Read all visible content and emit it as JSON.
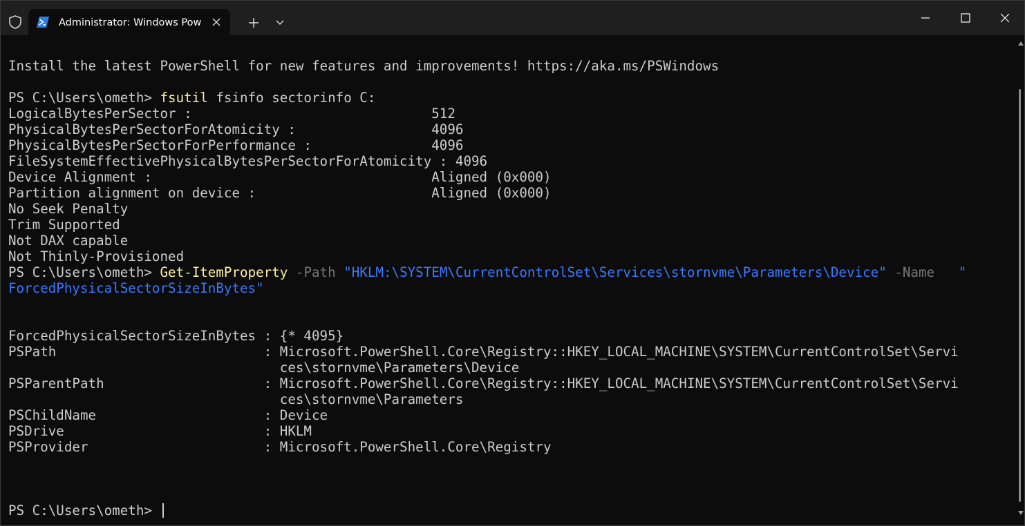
{
  "titlebar": {
    "tab_title": "Administrator: Windows PowerShell",
    "icons": [
      "shield-icon",
      "powershell-icon",
      "close-icon",
      "plus-icon",
      "chevron-down-icon",
      "minimize-icon",
      "maximize-icon",
      "close-icon"
    ]
  },
  "terminal": {
    "banner": "Install the latest PowerShell for new features and improvements! https://aka.ms/PSWindows",
    "cmd1": {
      "prompt": "PS C:\\Users\\ometh> ",
      "command": "fsutil",
      "args": " fsinfo sectorinfo C:"
    },
    "sectorinfo": [
      {
        "label": "LogicalBytesPerSector :                              ",
        "value": "512"
      },
      {
        "label": "PhysicalBytesPerSectorForAtomicity :                 ",
        "value": "4096"
      },
      {
        "label": "PhysicalBytesPerSectorForPerformance :               ",
        "value": "4096"
      },
      {
        "label": "FileSystemEffectivePhysicalBytesPerSectorForAtomicity : ",
        "value": "4096"
      },
      {
        "label": "Device Alignment :                                   ",
        "value": "Aligned (0x000)"
      },
      {
        "label": "Partition alignment on device :                      ",
        "value": "Aligned (0x000)"
      }
    ],
    "flags": [
      "No Seek Penalty",
      "Trim Supported",
      "Not DAX capable",
      "Not Thinly-Provisioned"
    ],
    "cmd2": {
      "prompt": "PS C:\\Users\\ometh> ",
      "command": "Get-ItemProperty",
      "param1": " -Path ",
      "path": "\"HKLM:\\SYSTEM\\CurrentControlSet\\Services\\stornvme\\Parameters\\Device\"",
      "param2": " -Name ",
      "name_open": "  \"",
      "name_cont": "ForcedPhysicalSectorSizeInBytes\""
    },
    "properties": [
      "ForcedPhysicalSectorSizeInBytes : {* 4095}",
      "PSPath                          : Microsoft.PowerShell.Core\\Registry::HKEY_LOCAL_MACHINE\\SYSTEM\\CurrentControlSet\\Servi",
      "                                  ces\\stornvme\\Parameters\\Device",
      "PSParentPath                    : Microsoft.PowerShell.Core\\Registry::HKEY_LOCAL_MACHINE\\SYSTEM\\CurrentControlSet\\Servi",
      "                                  ces\\stornvme\\Parameters",
      "PSChildName                     : Device",
      "PSDrive                         : HKLM",
      "PSProvider                      : Microsoft.PowerShell.Core\\Registry"
    ],
    "final_prompt": "PS C:\\Users\\ometh> "
  },
  "colors": {
    "background": "#0c0c0c",
    "titlebar": "#1f1f1f",
    "text": "#cccccc",
    "command": "#f9f1a5",
    "parameter": "#767676",
    "string": "#3b78ff"
  }
}
